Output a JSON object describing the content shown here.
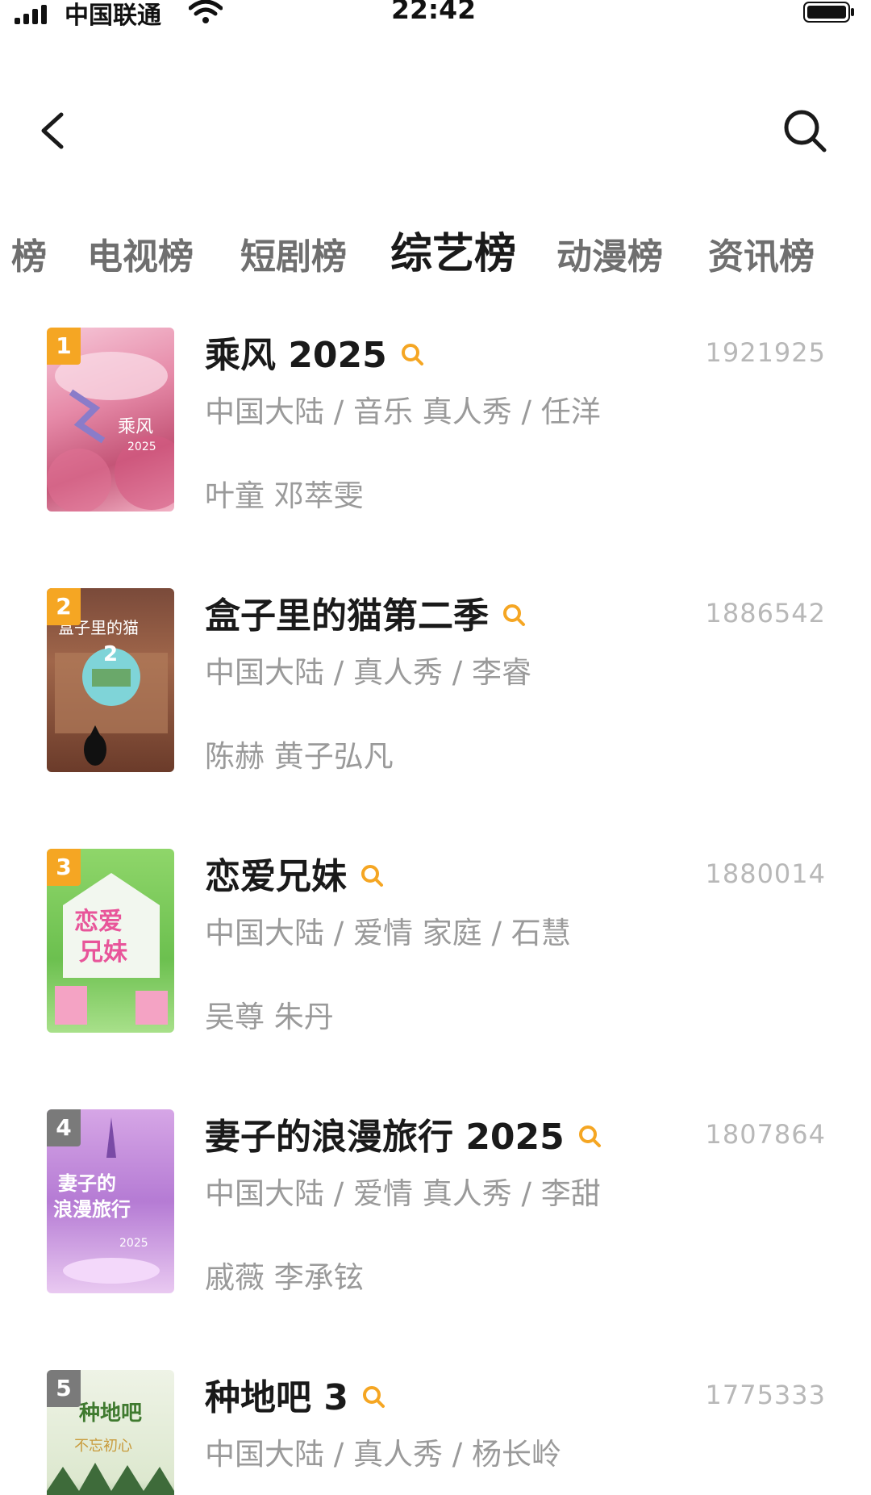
{
  "status_bar": {
    "carrier": "中国联通",
    "time": "22:42"
  },
  "header": {
    "back_icon": "chevron-left-icon",
    "search_icon": "search-icon"
  },
  "tabs": [
    {
      "label": "榜"
    },
    {
      "label": "电视榜"
    },
    {
      "label": "短剧榜"
    },
    {
      "label": "综艺榜",
      "active": true
    },
    {
      "label": "动漫榜"
    },
    {
      "label": "资讯榜"
    }
  ],
  "colors": {
    "accent": "#f5a623",
    "rank_top": "#f5a623",
    "rank_other": "#7a7a7a"
  },
  "items": [
    {
      "rank": "1",
      "title": "乘风 2025",
      "meta": "中国大陆 / 音乐 真人秀 / 任洋",
      "cast": "叶童 邓萃雯",
      "score": "1921925",
      "poster_text": "乘风2025"
    },
    {
      "rank": "2",
      "title": "盒子里的猫第二季",
      "meta": "中国大陆 / 真人秀 / 李睿",
      "cast": "陈赫 黄子弘凡",
      "score": "1886542",
      "poster_text": "盒子里的猫 2"
    },
    {
      "rank": "3",
      "title": "恋爱兄妹",
      "meta": "中国大陆 / 爱情 家庭 / 石慧",
      "cast": "吴尊 朱丹",
      "score": "1880014",
      "poster_text": "恋爱兄妹"
    },
    {
      "rank": "4",
      "title": "妻子的浪漫旅行 2025",
      "meta": "中国大陆 / 爱情 真人秀 / 李甜",
      "cast": "戚薇 李承铉",
      "score": "1807864",
      "poster_text": "妻子的浪漫旅行"
    },
    {
      "rank": "5",
      "title": "种地吧 3",
      "meta": "中国大陆 / 真人秀 / 杨长岭",
      "cast": "",
      "score": "1775333",
      "poster_text": "种地吧"
    }
  ]
}
